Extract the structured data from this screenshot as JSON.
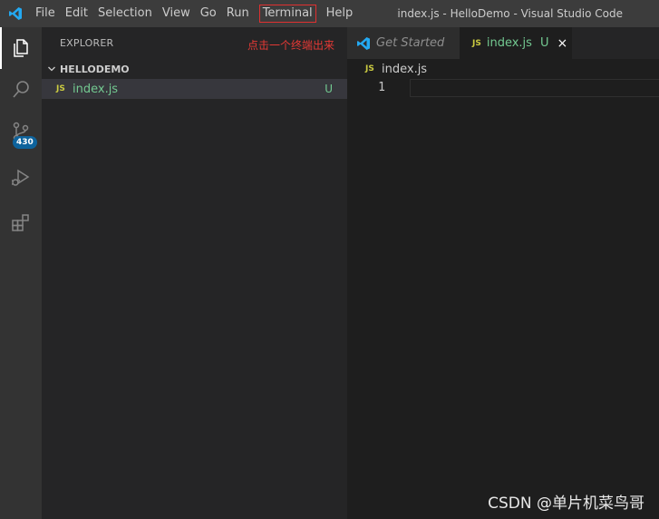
{
  "window": {
    "title": "index.js - HelloDemo - Visual Studio Code"
  },
  "menu": [
    "File",
    "Edit",
    "Selection",
    "View",
    "Go",
    "Run",
    "Terminal",
    "Help"
  ],
  "activity": {
    "scm_badge": "430"
  },
  "sidebar": {
    "header": "EXPLORER",
    "annotation": "点击一个终端出来",
    "folder": "HELLODEMO",
    "files": [
      {
        "name": "index.js",
        "icon_text": "JS",
        "status": "U"
      }
    ]
  },
  "tabs": [
    {
      "label": "Get Started",
      "active": false
    },
    {
      "label": "index.js",
      "icon_text": "JS",
      "status": "U",
      "close": "×",
      "active": true
    }
  ],
  "editor": {
    "breadcrumb_icon": "JS",
    "breadcrumb": "index.js",
    "line_number": "1"
  },
  "watermark": "CSDN @单片机菜鸟哥",
  "colors": {
    "accent": "#0e639c",
    "untracked": "#73c991",
    "js": "#cbcb41",
    "annotation": "#e53935"
  }
}
